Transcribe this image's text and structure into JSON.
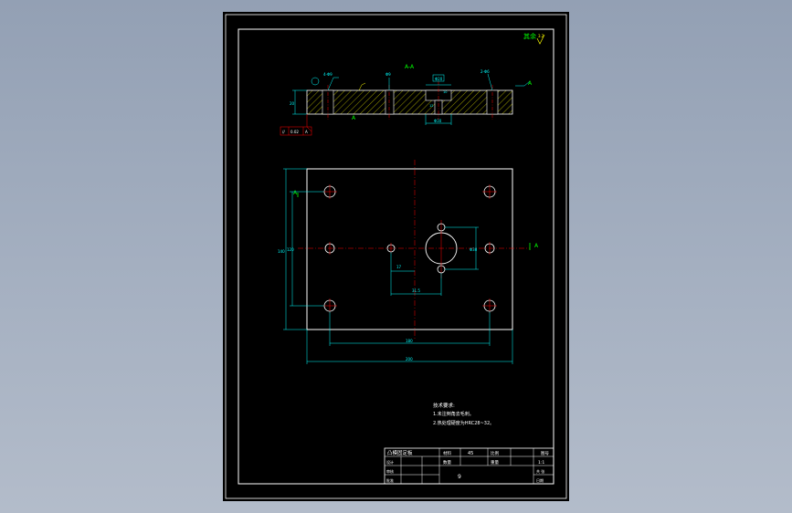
{
  "colors": {
    "background": "#a0abbd",
    "sheet": "#000000",
    "outline": "#ffffff",
    "dimension": "#00ffff",
    "centerline": "#ff0000",
    "hatch": "#ffff00",
    "annotation": "#00ff00"
  },
  "roughness_note": "其余",
  "roughness_symbol": "3.2",
  "section": {
    "title": "A-A",
    "hole_label_left": "4-Φ9",
    "hole_label_mid": "Φ9",
    "slot_width_label": "Φ20",
    "slot_depth_label": "10",
    "bottom_width_label": "Φ30",
    "hole_label_right": "2-Φ6",
    "datum_left": "A",
    "datum_right": "A",
    "thickness_label": "20",
    "depth_label": "12",
    "tolerance_frame": [
      "//",
      "0.02",
      "A"
    ]
  },
  "plan": {
    "section_mark_left": "A",
    "section_mark_right": "A",
    "dim_bottom_inner": "180",
    "dim_bottom_outer": "200",
    "dim_left_outer": "140",
    "dim_left_inner": "120",
    "dim_hole_offset": "17",
    "dim_hole_spacing": "31.5",
    "dim_big_hole": "Φ30"
  },
  "notes": {
    "title": "技术要求:",
    "lines": [
      "1.未注倒角去毛刺。",
      "2.热处理硬度为HRC28~32。"
    ]
  },
  "title_block": {
    "part_name": "凸模固定板",
    "material_label": "材料",
    "material": "45",
    "scale_label": "比例",
    "drawing_label": "图号",
    "designer": "设计",
    "checker": "审核",
    "quantity_label": "数量",
    "weight_label": "重量",
    "sheet_label": "共 张",
    "page": "1:1",
    "number": "9",
    "date_label": "日期",
    "approve_label": "批准"
  }
}
